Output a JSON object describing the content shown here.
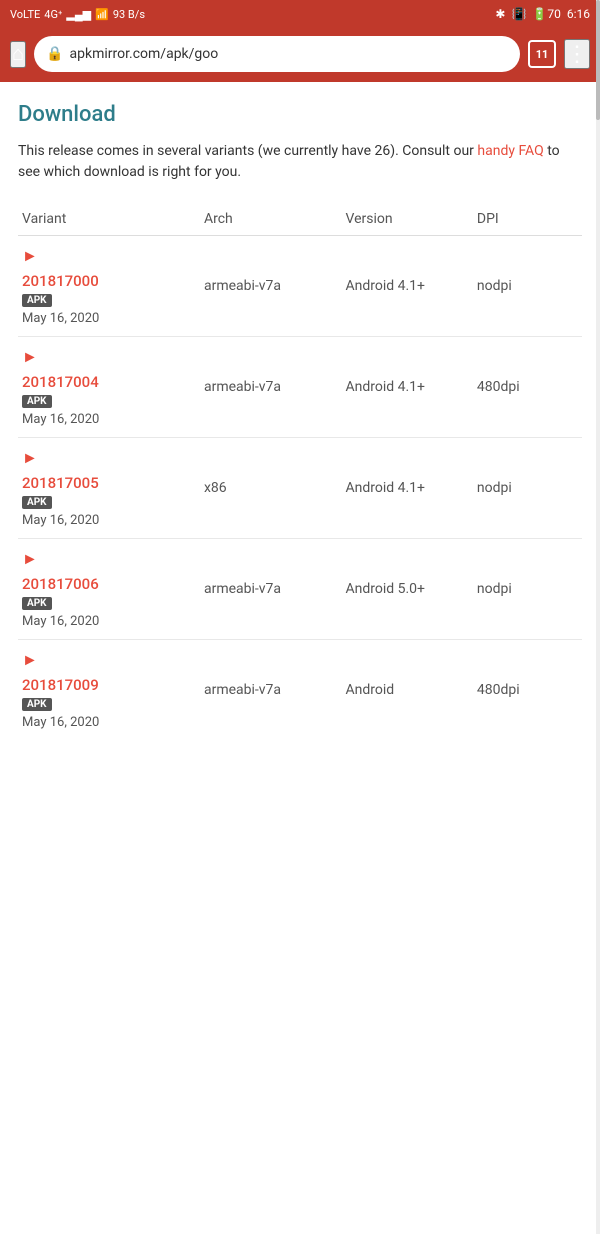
{
  "statusBar": {
    "leftItems": [
      "VoLTE",
      "4G",
      "signal",
      "wifi",
      "93 B/s"
    ],
    "rightItems": [
      "bluetooth",
      "vibrate",
      "battery_70",
      "6:16"
    ]
  },
  "browser": {
    "tabCount": "11",
    "urlText": "apkmirror.com/apk/goo",
    "homeIcon": "⌂",
    "lockIcon": "🔒",
    "menuIcon": "⋮"
  },
  "page": {
    "sectionTitle": "Download",
    "introText1": "This release comes in several variants (we currently have 26). Consult our ",
    "faqLinkText": "handy FAQ",
    "introText2": " to see which download is right for you.",
    "tableHeaders": {
      "variant": "Variant",
      "arch": "Arch",
      "version": "Version",
      "dpi": "DPI"
    },
    "variants": [
      {
        "id": "v1",
        "number": "201817000",
        "badge": "APK",
        "date": "May 16, 2020",
        "arch": "armeabi-v7a",
        "version": "Android 4.1+",
        "dpi": "nodpi"
      },
      {
        "id": "v2",
        "number": "201817004",
        "badge": "APK",
        "date": "May 16, 2020",
        "arch": "armeabi-v7a",
        "version": "Android 4.1+",
        "dpi": "480dpi"
      },
      {
        "id": "v3",
        "number": "201817005",
        "badge": "APK",
        "date": "May 16, 2020",
        "arch": "x86",
        "version": "Android 4.1+",
        "dpi": "nodpi"
      },
      {
        "id": "v4",
        "number": "201817006",
        "badge": "APK",
        "date": "May 16, 2020",
        "arch": "armeabi-v7a",
        "version": "Android 5.0+",
        "dpi": "nodpi"
      },
      {
        "id": "v5",
        "number": "201817009",
        "badge": "APK",
        "date": "May 16, 2020",
        "arch": "armeabi-v7a",
        "version": "Android",
        "dpi": "480dpi"
      }
    ]
  }
}
